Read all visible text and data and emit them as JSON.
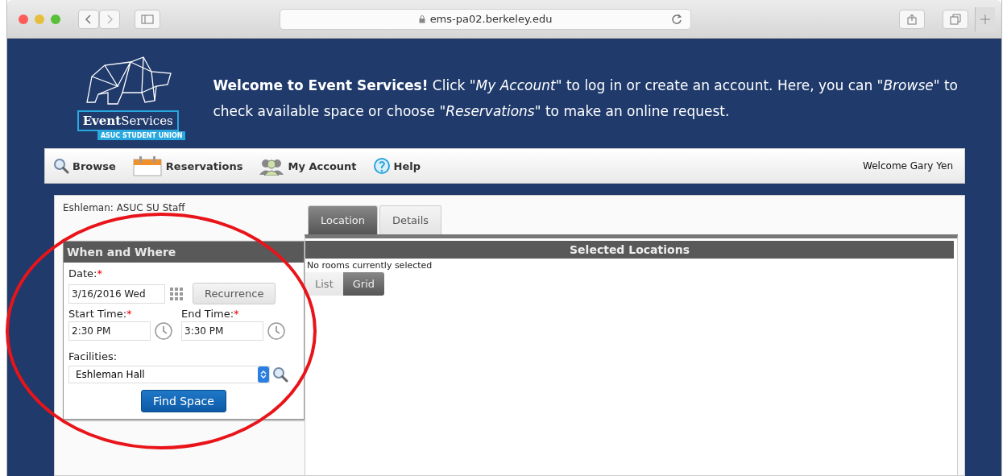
{
  "browser": {
    "url": "ems-pa02.berkeley.edu"
  },
  "header": {
    "logo_word": "**Event**Services",
    "logo_tagline": "ASUC STUDENT UNION",
    "welcome": "**Welcome to Event Services!** Click \"*My Account*\" to log in or create an account. Here, you can \"*Browse*\" to check available space or choose \"*Reservations*\" to make an online request."
  },
  "nav": {
    "items": [
      {
        "kind": "search",
        "label": "Browse"
      },
      {
        "kind": "calendar",
        "label": "Reservations"
      },
      {
        "kind": "people",
        "label": "My Account"
      },
      {
        "kind": "help",
        "label": "Help"
      }
    ],
    "greeting": "Welcome Gary Yen"
  },
  "left_panel": {
    "user_group": "Eshleman: ASUC SU Staff",
    "when_where": {
      "title": "When and Where",
      "date": {
        "label": "Date:",
        "required_mark": "*",
        "value": "3/16/2016 Wed"
      },
      "recurrence_button": "Recurrence",
      "start_time": {
        "label": "Start Time:",
        "required_mark": "*",
        "value": "2:30 PM"
      },
      "end_time": {
        "label": "End Time:",
        "required_mark": "*",
        "value": "3:30 PM"
      },
      "facilities": {
        "label": "Facilities:",
        "value": "Eshleman Hall"
      },
      "find_button": "Find Space"
    }
  },
  "tabs": [
    {
      "label": "Location",
      "selected": true
    },
    {
      "label": "Details",
      "selected": false
    }
  ],
  "selected_locations": {
    "title": "Selected Locations",
    "empty_message": "No rooms currently selected",
    "view_toggle": [
      {
        "label": "List",
        "selected": false
      },
      {
        "label": "Grid",
        "selected": true
      }
    ]
  }
}
